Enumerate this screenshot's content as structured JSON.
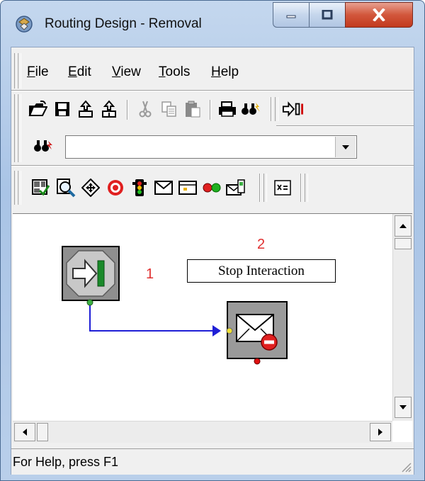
{
  "window": {
    "title": "Routing Design - Removal",
    "icon": "routing-design-app-icon",
    "controls": {
      "minimize": "minimize-icon",
      "maximize": "maximize-icon",
      "close": "close-icon"
    }
  },
  "menu": {
    "items": [
      {
        "label": "File",
        "accel": "F",
        "rest": "ile"
      },
      {
        "label": "Edit",
        "accel": "E",
        "rest": "dit"
      },
      {
        "label": "View",
        "accel": "V",
        "rest": "iew"
      },
      {
        "label": "Tools",
        "accel": "T",
        "rest": "ools"
      },
      {
        "label": "Help",
        "accel": "H",
        "rest": "elp"
      }
    ]
  },
  "toolbar1": {
    "icons": [
      "open-folder-icon",
      "save-icon",
      "export-icon",
      "import-icon",
      "cut-icon",
      "copy-icon",
      "paste-icon",
      "print-icon",
      "find-icon",
      "run-arrow-icon"
    ]
  },
  "toolbar2": {
    "combo_value": "",
    "icons": [
      "find-icon",
      "dropdown-arrow-icon"
    ]
  },
  "toolbar3": {
    "icons": [
      "checklist-icon",
      "inspect-icon",
      "target-move-icon",
      "stop-target-icon",
      "traffic-light-icon",
      "envelope-icon",
      "card-icon",
      "red-green-icon",
      "email-box-icon",
      "variable-icon"
    ]
  },
  "canvas": {
    "callout_numbers": [
      "1",
      "2"
    ],
    "nodes": [
      {
        "name": "entry-point-node",
        "icon": "entry-arrow-icon",
        "port_color": "#3cb043"
      },
      {
        "name": "stop-interaction-node",
        "icon": "mail-stop-icon",
        "port_color": "#e01010"
      }
    ],
    "connector_color": "#1f1fd6",
    "stop_label": "Stop Interaction"
  },
  "status": {
    "text": "For Help, press F1"
  }
}
